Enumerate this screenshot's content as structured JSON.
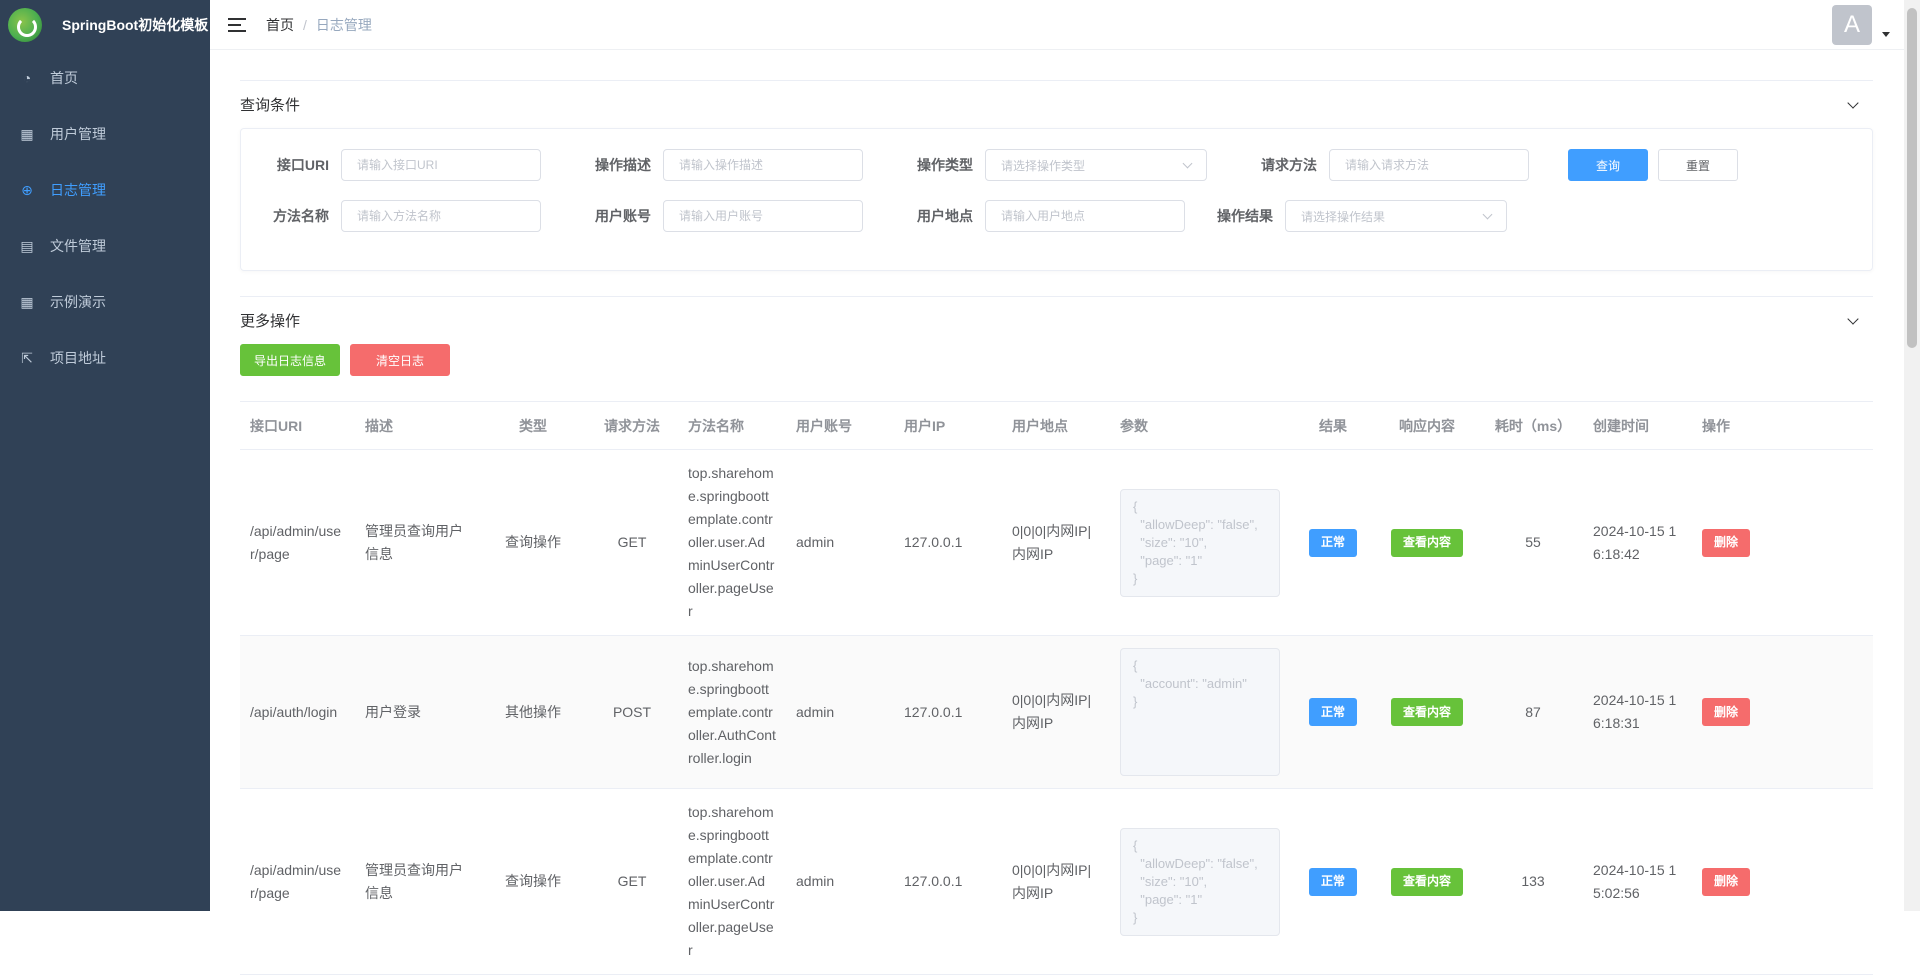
{
  "app": {
    "title": "SpringBoot初始化模板"
  },
  "sidebar": {
    "items": [
      {
        "label": "首页",
        "icon": "dashboard-icon"
      },
      {
        "label": "用户管理",
        "icon": "grid-icon"
      },
      {
        "label": "日志管理",
        "icon": "log-icon"
      },
      {
        "label": "文件管理",
        "icon": "clipboard-icon"
      },
      {
        "label": "示例演示",
        "icon": "grid-icon"
      },
      {
        "label": "项目地址",
        "icon": "external-link-icon"
      }
    ]
  },
  "breadcrumb": {
    "home": "首页",
    "sep": "/",
    "current": "日志管理"
  },
  "avatar": {
    "letter": "A"
  },
  "query": {
    "title": "查询条件",
    "fields": {
      "uri_label": "接口URI",
      "uri_placeholder": "请输入接口URI",
      "desc_label": "操作描述",
      "desc_placeholder": "请输入操作描述",
      "type_label": "操作类型",
      "type_placeholder": "请选择操作类型",
      "method_label": "请求方法",
      "method_placeholder": "请输入请求方法",
      "fn_label": "方法名称",
      "fn_placeholder": "请输入方法名称",
      "account_label": "用户账号",
      "account_placeholder": "请输入用户账号",
      "location_label": "用户地点",
      "location_placeholder": "请输入用户地点",
      "result_label": "操作结果",
      "result_placeholder": "请选择操作结果"
    },
    "search_btn": "查询",
    "reset_btn": "重置"
  },
  "more": {
    "title": "更多操作",
    "export_btn": "导出日志信息",
    "clear_btn": "清空日志"
  },
  "table": {
    "headers": [
      "接口URI",
      "描述",
      "类型",
      "请求方法",
      "方法名称",
      "用户账号",
      "用户IP",
      "用户地点",
      "参数",
      "结果",
      "响应内容",
      "耗时（ms）",
      "创建时间",
      "操作"
    ],
    "rows": [
      {
        "uri": "/api/admin/user/page",
        "desc": "管理员查询用户信息",
        "type": "查询操作",
        "method": "GET",
        "fn": "top.sharehome.springboottemplate.controller.user.AdminUserController.pageUser",
        "account": "admin",
        "ip": "127.0.0.1",
        "location": "0|0|0|内网IP|内网IP",
        "params": "{\n  \"allowDeep\": \"false\",\n  \"size\": \"10\",\n  \"page\": \"1\"\n}",
        "result": "正常",
        "view": "查看内容",
        "cost": "55",
        "time": "2024-10-15 16:18:42",
        "delete": "删除"
      },
      {
        "uri": "/api/auth/login",
        "desc": "用户登录",
        "type": "其他操作",
        "method": "POST",
        "fn": "top.sharehome.springboottemplate.controller.AuthController.login",
        "account": "admin",
        "ip": "127.0.0.1",
        "location": "0|0|0|内网IP|内网IP",
        "params": "{\n  \"account\": \"admin\"\n}",
        "result": "正常",
        "view": "查看内容",
        "cost": "87",
        "time": "2024-10-15 16:18:31",
        "delete": "删除"
      },
      {
        "uri": "/api/admin/user/page",
        "desc": "管理员查询用户信息",
        "type": "查询操作",
        "method": "GET",
        "fn": "top.sharehome.springboottemplate.controller.user.AdminUserController.pageUser",
        "account": "admin",
        "ip": "127.0.0.1",
        "location": "0|0|0|内网IP|内网IP",
        "params": "{\n  \"allowDeep\": \"false\",\n  \"size\": \"10\",\n  \"page\": \"1\"\n}",
        "result": "正常",
        "view": "查看内容",
        "cost": "133",
        "time": "2024-10-15 15:02:56",
        "delete": "删除"
      }
    ]
  }
}
